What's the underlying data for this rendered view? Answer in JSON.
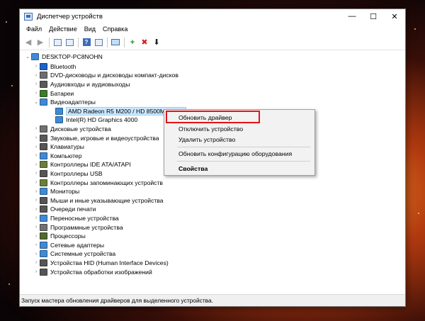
{
  "window": {
    "title": "Диспетчер устройств",
    "minimize_glyph": "—",
    "maximize_glyph": "☐",
    "close_glyph": "✕"
  },
  "menu": [
    "Файл",
    "Действие",
    "Вид",
    "Справка"
  ],
  "toolbar": {
    "back_glyph": "◀",
    "forward_glyph": "▶",
    "add_driver_glyph": "+",
    "remove_glyph": "✖",
    "download_glyph": "⬇",
    "help_glyph": "?"
  },
  "tree": {
    "root": "DESKTOP-PC8NOHN",
    "expanded_glyph": "⌄",
    "collapsed_glyph": "›",
    "items": [
      {
        "label": "Bluetooth",
        "icon": "bluetooth-icon",
        "color": "#1c62c9"
      },
      {
        "label": "DVD-дисководы и дисководы компакт-дисков",
        "icon": "dvd-icon",
        "color": "#6d6d6d"
      },
      {
        "label": "Аудиовходы и аудиовыходы",
        "icon": "speaker-icon",
        "color": "#5a5a5a"
      },
      {
        "label": "Батареи",
        "icon": "battery-icon",
        "color": "#3d7a2a"
      },
      {
        "label": "Видеоадаптеры",
        "icon": "display-adapter-icon",
        "color": "#3e8ad6",
        "expanded": true
      },
      {
        "label": "AMD Radeon R5 M200 / HD 8500M Series",
        "icon": "display-adapter-icon",
        "color": "#3e8ad6",
        "child": true,
        "selected": true
      },
      {
        "label": "Intel(R) HD Graphics 4000",
        "icon": "display-adapter-icon",
        "color": "#3e8ad6",
        "child": true
      },
      {
        "label": "Дисковые устройства",
        "icon": "disk-icon",
        "color": "#707070"
      },
      {
        "label": "Звуковые, игровые и видеоустройства",
        "icon": "sound-icon",
        "color": "#5a5a5a"
      },
      {
        "label": "Клавиатуры",
        "icon": "keyboard-icon",
        "color": "#555555"
      },
      {
        "label": "Компьютер",
        "icon": "computer-icon",
        "color": "#3e8ad6"
      },
      {
        "label": "Контроллеры IDE ATA/ATAPI",
        "icon": "ide-controller-icon",
        "color": "#6a7f3a"
      },
      {
        "label": "Контроллеры USB",
        "icon": "usb-icon",
        "color": "#555555"
      },
      {
        "label": "Контроллеры запоминающих устройств",
        "icon": "storage-controller-icon",
        "color": "#6a7f3a"
      },
      {
        "label": "Мониторы",
        "icon": "monitor-icon",
        "color": "#3e8ad6"
      },
      {
        "label": "Мыши и иные указывающие устройства",
        "icon": "mouse-icon",
        "color": "#555555"
      },
      {
        "label": "Очереди печати",
        "icon": "printer-icon",
        "color": "#555555"
      },
      {
        "label": "Переносные устройства",
        "icon": "portable-device-icon",
        "color": "#3e8ad6"
      },
      {
        "label": "Программные устройства",
        "icon": "software-device-icon",
        "color": "#707070"
      },
      {
        "label": "Процессоры",
        "icon": "processor-icon",
        "color": "#4f6a2f"
      },
      {
        "label": "Сетевые адаптеры",
        "icon": "network-adapter-icon",
        "color": "#3e8ad6"
      },
      {
        "label": "Системные устройства",
        "icon": "system-device-icon",
        "color": "#3e8ad6"
      },
      {
        "label": "Устройства HID (Human Interface Devices)",
        "icon": "hid-icon",
        "color": "#555555"
      },
      {
        "label": "Устройства обработки изображений",
        "icon": "camera-icon",
        "color": "#555555"
      }
    ]
  },
  "context_menu": {
    "update_driver": "Обновить драйвер",
    "disable_device": "Отключить устройство",
    "uninstall_device": "Удалить устройство",
    "scan_hardware": "Обновить конфигурацию оборудования",
    "properties": "Свойства"
  },
  "status": "Запуск мастера обновления драйверов для выделенного устройства.",
  "colors": {
    "highlight_border": "#e3151a",
    "selection_bg": "#cce8ff"
  }
}
